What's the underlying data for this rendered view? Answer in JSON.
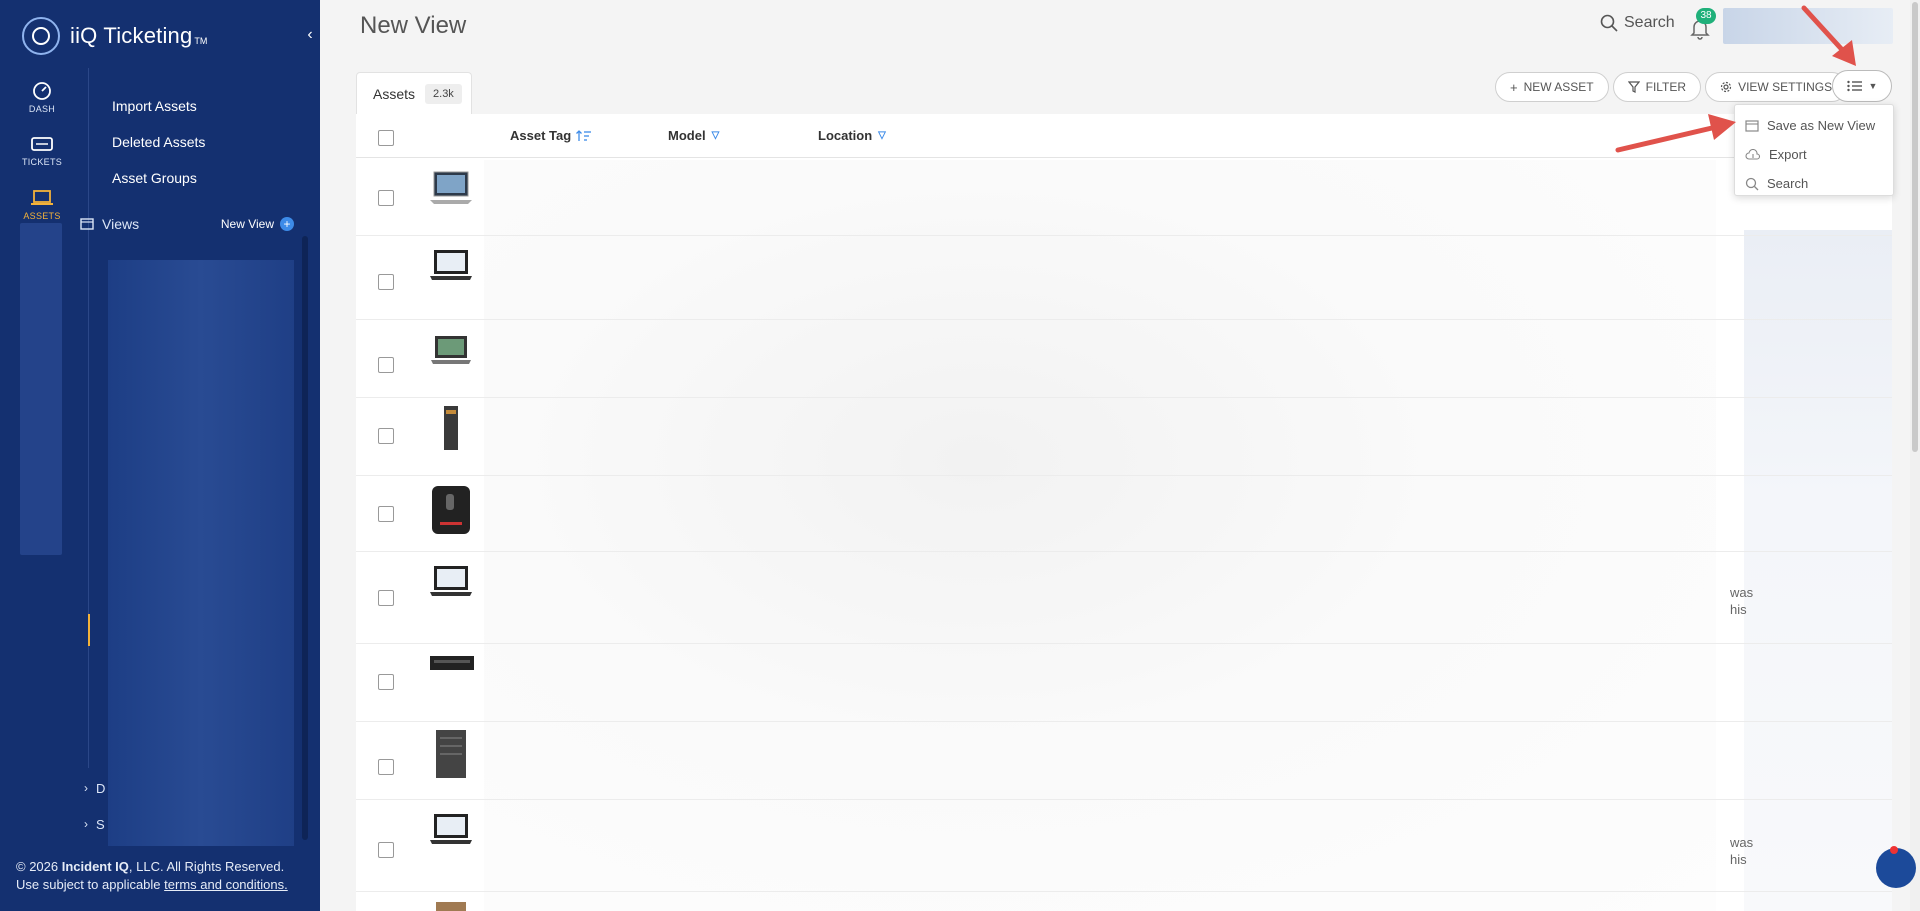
{
  "brand": {
    "name": "iiQ Ticketing",
    "tm": "TM"
  },
  "rail": [
    {
      "label": "DASH",
      "icon": "dashboard-icon"
    },
    {
      "label": "TICKETS",
      "icon": "ticket-icon"
    },
    {
      "label": "ASSETS",
      "icon": "laptop-icon",
      "active": true
    }
  ],
  "subnav": [
    "Import Assets",
    "Deleted Assets",
    "Asset Groups"
  ],
  "views": {
    "label": "Views",
    "new_view": "New View"
  },
  "collapsed": [
    "D",
    "S"
  ],
  "footer": {
    "copyright_prefix": "© 2026 ",
    "company": "Incident IQ",
    "copyright_suffix": ", LLC. All Rights Reserved.",
    "terms_prefix": "Use subject to applicable ",
    "terms_link": "terms and conditions."
  },
  "page": {
    "title": "New View"
  },
  "header": {
    "search_label": "Search",
    "notifications_count": "38"
  },
  "tab": {
    "label": "Assets",
    "count": "2.3k"
  },
  "toolbar": {
    "new_asset": "NEW ASSET",
    "filter": "FILTER",
    "view_settings": "VIEW SETTINGS"
  },
  "columns": [
    "Asset Tag",
    "Model",
    "Location"
  ],
  "rows_visible": 10,
  "truncated_text": {
    "line1": "was",
    "line2": "his"
  },
  "dropdown": {
    "items": [
      {
        "label": "Save as New View",
        "icon": "save-view-icon"
      },
      {
        "label": "Export",
        "icon": "cloud-download-icon"
      },
      {
        "label": "Search",
        "icon": "search-icon"
      }
    ]
  },
  "colors": {
    "sidebar": "#143070",
    "accent": "#f3b23a",
    "arrow": "#e0524b",
    "badge": "#1fb07a"
  }
}
